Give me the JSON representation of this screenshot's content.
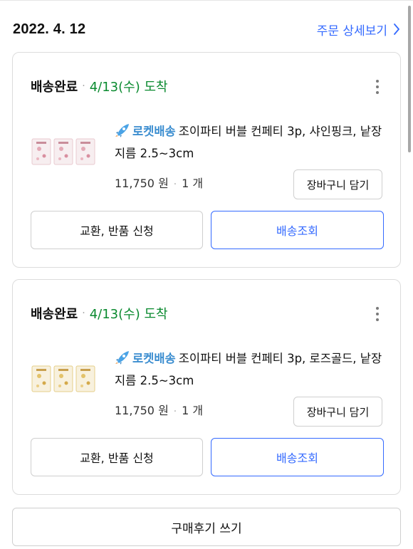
{
  "order": {
    "date": "2022. 4. 12",
    "detail_link": "주문 상세보기"
  },
  "rocket": {
    "label": "로켓배송",
    "icon": "rocket-icon"
  },
  "items": [
    {
      "status": "배송완료",
      "arrival": "4/13(수) 도착",
      "name": "조이파티 버블 컨페티 3p, 샤인핑크, 낱장지름 2.5~3cm",
      "price": "11,750 원",
      "quantity": "1 개",
      "cart_button": "장바구니 담기",
      "exchange_button": "교환, 반품 신청",
      "tracking_button": "배송조회",
      "thumb_color": "#e9c9cf"
    },
    {
      "status": "배송완료",
      "arrival": "4/13(수) 도착",
      "name": "조이파티 버블 컨페티 3p, 로즈골드, 낱장지름 2.5~3cm",
      "price": "11,750 원",
      "quantity": "1 개",
      "cart_button": "장바구니 담기",
      "exchange_button": "교환, 반품 신청",
      "tracking_button": "배송조회",
      "thumb_color": "#e6cf8a"
    }
  ],
  "review_button": "구매후기 쓰기",
  "colors": {
    "accent_blue": "#346aff",
    "arrival_green": "#0a8a2f",
    "rocket_blue": "#3c8ed0"
  }
}
